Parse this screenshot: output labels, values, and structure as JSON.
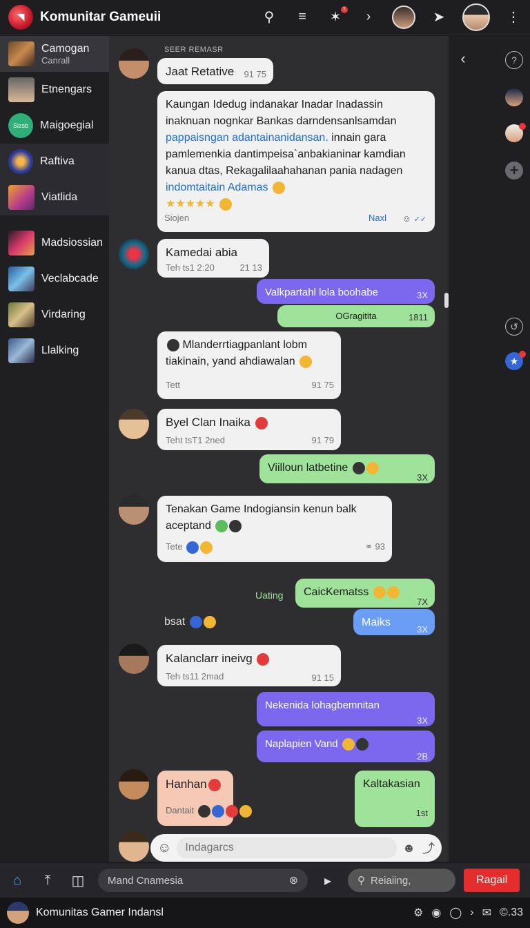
{
  "header": {
    "title": "Komunitar Gameuii",
    "badge": "1"
  },
  "sidebar": {
    "items": [
      {
        "label": "Camogan",
        "sub": "Canrall"
      },
      {
        "label": "Etnengars",
        "sub": ""
      },
      {
        "label": "Maigoegial",
        "sub": "",
        "thumb_text": "Sizsb"
      },
      {
        "label": "Raftiva",
        "sub": ""
      },
      {
        "label": "Viatlida",
        "sub": ""
      },
      {
        "label": "Madsiossian",
        "sub": ""
      },
      {
        "label": "Veclabcade",
        "sub": ""
      },
      {
        "label": "Virdaring",
        "sub": ""
      },
      {
        "label": "Llalking",
        "sub": ""
      }
    ]
  },
  "chat": {
    "section_label": "SEER REMASR",
    "m1": {
      "text": "Jaat Retative",
      "time": "91 75"
    },
    "m2": {
      "line1": "Kaungan Idedug indanakar Inadar Inadassin",
      "line2": "inaknuan nognkar Bankas darndensanlsamdan",
      "link1": "pappaisngan adantainanidansan.",
      "line3": " innain gara",
      "line4": "pamlemenkia dantimpeisa`anbakianinar kamdian",
      "line5": "kanua dtas, Rekagalilaahahanan pania nadagen",
      "link2": "indomtaitain Adamas",
      "stars": "★★★★★",
      "footer_left": "Siojen",
      "footer_right": "Naxl"
    },
    "m3": {
      "text": "Kamedai abia",
      "sub": "Teh ts1 2:20",
      "time": "21 13"
    },
    "m4": {
      "text": "Valkpartahl lola boohabe",
      "time": "3X"
    },
    "m5": {
      "text": "OGragitita",
      "time": "1811"
    },
    "m6": {
      "line1": "Mlanderrtiagpanlant lobm",
      "line2": "tiakinain, yand ahdiawalan",
      "sub": "Tett",
      "time": "91 75"
    },
    "m7": {
      "text": "Byel Clan Inaika",
      "sub": "Teht tsT1 2ned",
      "time": "91 79"
    },
    "m8": {
      "text": "Viilloun latbetine",
      "time": "3X"
    },
    "m9": {
      "line1": "Tenakan Game Indogiansin kenun balk",
      "line2": "aceptand",
      "sub": "Tete",
      "time": "93"
    },
    "m10": {
      "label": "Uating",
      "text": "CaicKematss",
      "time": "7X"
    },
    "m11": {
      "text": "Maiks",
      "time": "3X"
    },
    "m12": {
      "text": "bsat"
    },
    "m13": {
      "text": "Kalanclarr ineivg",
      "sub": "Teh ts11 2mad",
      "time": "91 15"
    },
    "m14": {
      "text": "Nekenida lohagbemnitan",
      "time": "3X"
    },
    "m15": {
      "text": "Naplapien Vand",
      "time": "2B"
    },
    "m16": {
      "text": "Hanhan",
      "sub": "Dantait"
    },
    "m17": {
      "text": "Kaltakasian",
      "time": "1st"
    }
  },
  "composer": {
    "placeholder": "Indagarcs"
  },
  "bottombar": {
    "search_placeholder": "Mand Cnamesia",
    "secondary": "Reiaiing,",
    "cta": "Ragail"
  },
  "statusbar": {
    "title": "Komunitas Gamer Indansl",
    "time": "©.33"
  }
}
